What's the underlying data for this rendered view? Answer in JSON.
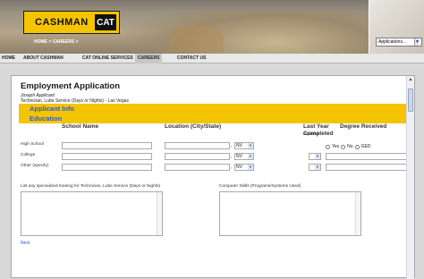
{
  "brand": {
    "logo_text": "CASHMAN",
    "cat_text": "CAT"
  },
  "breadcrumb": "HOME > CAREERS >",
  "app_selector": {
    "value": "Applications...",
    "arrow": "▼"
  },
  "nav": {
    "items": [
      "HOME",
      "ABOUT CASHMAN",
      "CAT ONLINE SERVICES",
      "CAREERS",
      "CONTACT US"
    ],
    "active": "CAREERS"
  },
  "form": {
    "title": "Employment Application",
    "applicant_name": "Joseph Applicant",
    "position": "Technician, Lube Service (Days or Nights) - Las Vegas",
    "sections": [
      "Applicant Info",
      "Education"
    ],
    "columns": {
      "school": "School Name",
      "location": "Location (City/State)",
      "last_year": "Last Year Completed",
      "degree": "Degree Received"
    },
    "rows": [
      {
        "label": "High School",
        "state": "NV",
        "last_year": "Diploma",
        "degree_options": [
          "Yes",
          "No",
          "GED"
        ]
      },
      {
        "label": "College",
        "state": "NV",
        "last_year": ""
      },
      {
        "label": "Other (specify)",
        "state": "NV",
        "last_year": ""
      }
    ],
    "training_label": "List any specialized training for Technician, Lube Service (Days or Nights)",
    "skills_label": "Computer Skills (Programs/Systems Used)",
    "next_label": "Next"
  },
  "colors": {
    "accent_yellow": "#f5c400",
    "link_blue": "#2a5bd7"
  }
}
